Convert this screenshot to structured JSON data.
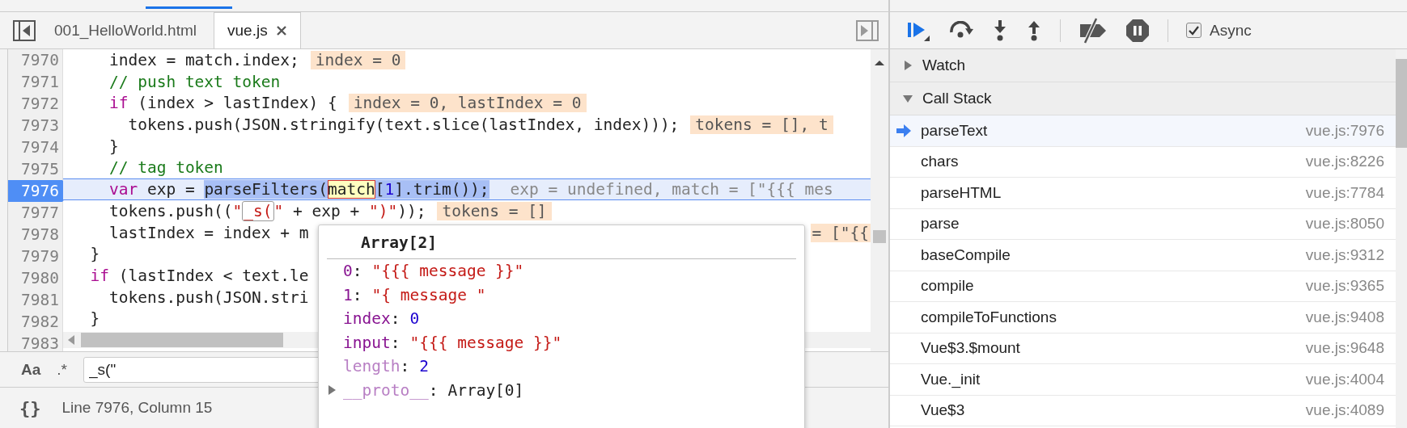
{
  "editor": {
    "tabs": [
      {
        "label": "001_HelloWorld.html",
        "selected": false
      },
      {
        "label": "vue.js",
        "selected": true
      }
    ],
    "lines": [
      {
        "number": "7970",
        "current": false,
        "segments": [
          {
            "text": "    index = match.index;",
            "kind": "plain"
          },
          {
            "text": "index = 0",
            "kind": "value"
          }
        ]
      },
      {
        "number": "7971",
        "current": false,
        "segments": [
          {
            "text": "    // push text token",
            "kind": "comment"
          }
        ]
      },
      {
        "number": "7972",
        "current": false,
        "segments": [
          {
            "text": "    if",
            "kind": "keyword"
          },
          {
            "text": " (index > lastIndex) {",
            "kind": "plain"
          },
          {
            "text": "index = 0, lastIndex = 0",
            "kind": "value"
          }
        ]
      },
      {
        "number": "7973",
        "current": false,
        "segments": [
          {
            "text": "      tokens.push(JSON.stringify(text.slice(lastIndex, index)));",
            "kind": "plain"
          },
          {
            "text": "tokens = [], t",
            "kind": "value"
          }
        ]
      },
      {
        "number": "7974",
        "current": false,
        "segments": [
          {
            "text": "    }",
            "kind": "plain"
          }
        ]
      },
      {
        "number": "7975",
        "current": false,
        "segments": [
          {
            "text": "    // tag token",
            "kind": "comment"
          }
        ]
      },
      {
        "number": "7976",
        "current": true,
        "segments": [
          {
            "text": "    var",
            "kind": "keyword"
          },
          {
            "text": " exp = ",
            "kind": "plain"
          },
          {
            "text": "parseFilters(",
            "kind": "selection"
          },
          {
            "text": "match",
            "kind": "match"
          },
          {
            "text": "[",
            "kind": "selection"
          },
          {
            "text": "1",
            "kind": "selected-number"
          },
          {
            "text": "].trim());",
            "kind": "selection"
          },
          {
            "text": "exp = undefined, match = [\"{{{ mes",
            "kind": "hint"
          }
        ]
      },
      {
        "number": "7977",
        "current": false,
        "segments": [
          {
            "text": "    tokens.push((",
            "kind": "plain"
          },
          {
            "text": "\"",
            "kind": "string"
          },
          {
            "text": "_s(",
            "kind": "search"
          },
          {
            "text": "\"",
            "kind": "string"
          },
          {
            "text": " + exp + ",
            "kind": "plain"
          },
          {
            "text": "\")\"",
            "kind": "string"
          },
          {
            "text": "));",
            "kind": "plain"
          },
          {
            "text": "tokens = []",
            "kind": "value"
          }
        ]
      },
      {
        "number": "7978",
        "current": false,
        "segments": [
          {
            "text": "    lastIndex = index + m",
            "kind": "plain"
          }
        ],
        "trailing": {
          "text": "= [\"{{",
          "kind": "value"
        }
      },
      {
        "number": "7979",
        "current": false,
        "segments": [
          {
            "text": "  }",
            "kind": "plain"
          }
        ]
      },
      {
        "number": "7980",
        "current": false,
        "segments": [
          {
            "text": "  if",
            "kind": "keyword"
          },
          {
            "text": " (lastIndex < text.le",
            "kind": "plain"
          }
        ]
      },
      {
        "number": "7981",
        "current": false,
        "segments": [
          {
            "text": "    tokens.push(JSON.stri",
            "kind": "plain"
          }
        ]
      },
      {
        "number": "7982",
        "current": false,
        "segments": [
          {
            "text": "  }",
            "kind": "plain"
          }
        ]
      },
      {
        "number": "7983",
        "current": false
      }
    ],
    "search": {
      "case_toggle": "Aa",
      "regex_toggle": ".*",
      "value": "_s(\""
    },
    "status_bar": {
      "format_button": "{}",
      "position": "Line 7976, Column 15"
    },
    "popover": {
      "title": "Array[2]",
      "properties": [
        {
          "key": "0",
          "separator": ":",
          "value": "\"{{{ message }}\"",
          "kind": "string",
          "dimmed": false
        },
        {
          "key": "1",
          "separator": ":",
          "value": "\"{ message \"",
          "kind": "string",
          "dimmed": false
        },
        {
          "key": "index",
          "separator": ":",
          "value": "0",
          "kind": "number",
          "dimmed": false
        },
        {
          "key": "input",
          "separator": ":",
          "value": "\"{{{ message }}\"",
          "kind": "string",
          "dimmed": false
        },
        {
          "key": "length",
          "separator": ":",
          "value": "2",
          "kind": "number",
          "dimmed": true
        },
        {
          "key": "__proto__",
          "separator": ":",
          "value": "Array[0]",
          "kind": "object",
          "dimmed": true
        }
      ]
    }
  },
  "debugger": {
    "async": {
      "label": "Async",
      "checked": true
    },
    "sections": [
      {
        "title": "Watch",
        "expanded": false
      },
      {
        "title": "Call Stack",
        "expanded": true,
        "frames": [
          {
            "name": "parseText",
            "location": "vue.js:7976",
            "selected": true
          },
          {
            "name": "chars",
            "location": "vue.js:8226",
            "selected": false
          },
          {
            "name": "parseHTML",
            "location": "vue.js:7784",
            "selected": false
          },
          {
            "name": "parse",
            "location": "vue.js:8050",
            "selected": false
          },
          {
            "name": "baseCompile",
            "location": "vue.js:9312",
            "selected": false
          },
          {
            "name": "compile",
            "location": "vue.js:9365",
            "selected": false
          },
          {
            "name": "compileToFunctions",
            "location": "vue.js:9408",
            "selected": false
          },
          {
            "name": "Vue$3.$mount",
            "location": "vue.js:9648",
            "selected": false
          },
          {
            "name": "Vue._init",
            "location": "vue.js:4004",
            "selected": false
          },
          {
            "name": "Vue$3",
            "location": "vue.js:4089",
            "selected": false
          }
        ]
      }
    ]
  }
}
